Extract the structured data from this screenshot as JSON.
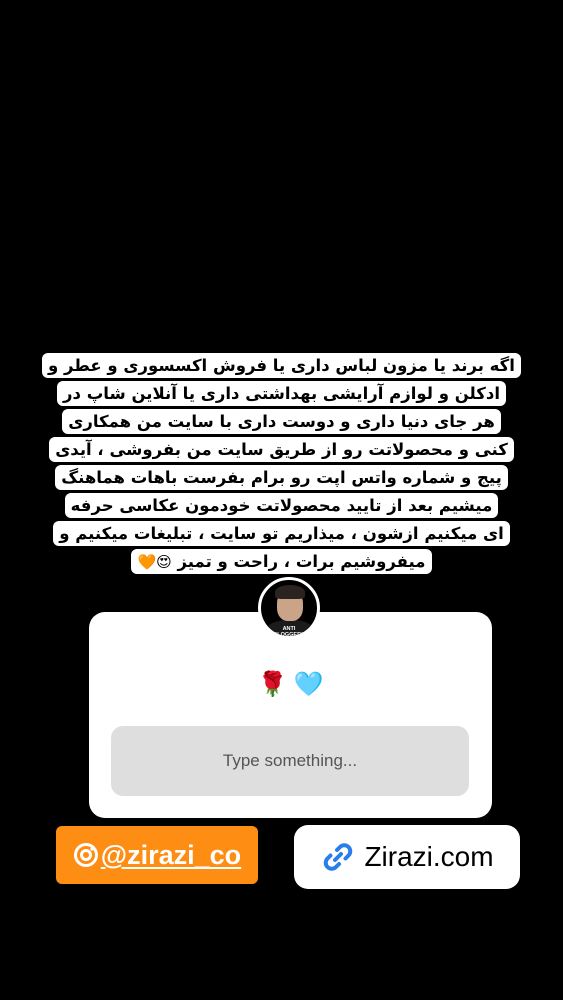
{
  "caption": {
    "lines": [
      "اگه برند یا مزون لباس داری یا فروش اکسسوری و عطر و",
      "ادکلن و لوازم آرایشی بهداشتی داری یا آنلاین شاپ در",
      "هر جای دنیا داری و دوست داری با سایت من همکاری",
      "کنی و محصولاتت رو از طریق سایت من بفروشی ، آیدی",
      "پیج و شماره واتس اپت رو برام بفرست باهات هماهنگ",
      "میشیم بعد از تایید محصولاتت خودمون عکاسی حرفه",
      "ای میکنیم ازشون ، میذاریم تو سایت ، تبلیغات میکنیم و",
      "میفروشیم برات ، راحت و تمیز"
    ],
    "end_emojis": "😍🧡"
  },
  "question_sticker": {
    "avatar_tag": "ANTI BLOGGERS",
    "prompt_emojis": [
      "🌹",
      "🩵"
    ],
    "input_placeholder": "Type something..."
  },
  "mention_sticker": {
    "icon": "instagram-icon",
    "handle": "@zirazi_co",
    "color": "#fd8d13"
  },
  "link_sticker": {
    "icon": "link-icon",
    "text": "Zirazi.com",
    "icon_color": "#2b7de9"
  }
}
